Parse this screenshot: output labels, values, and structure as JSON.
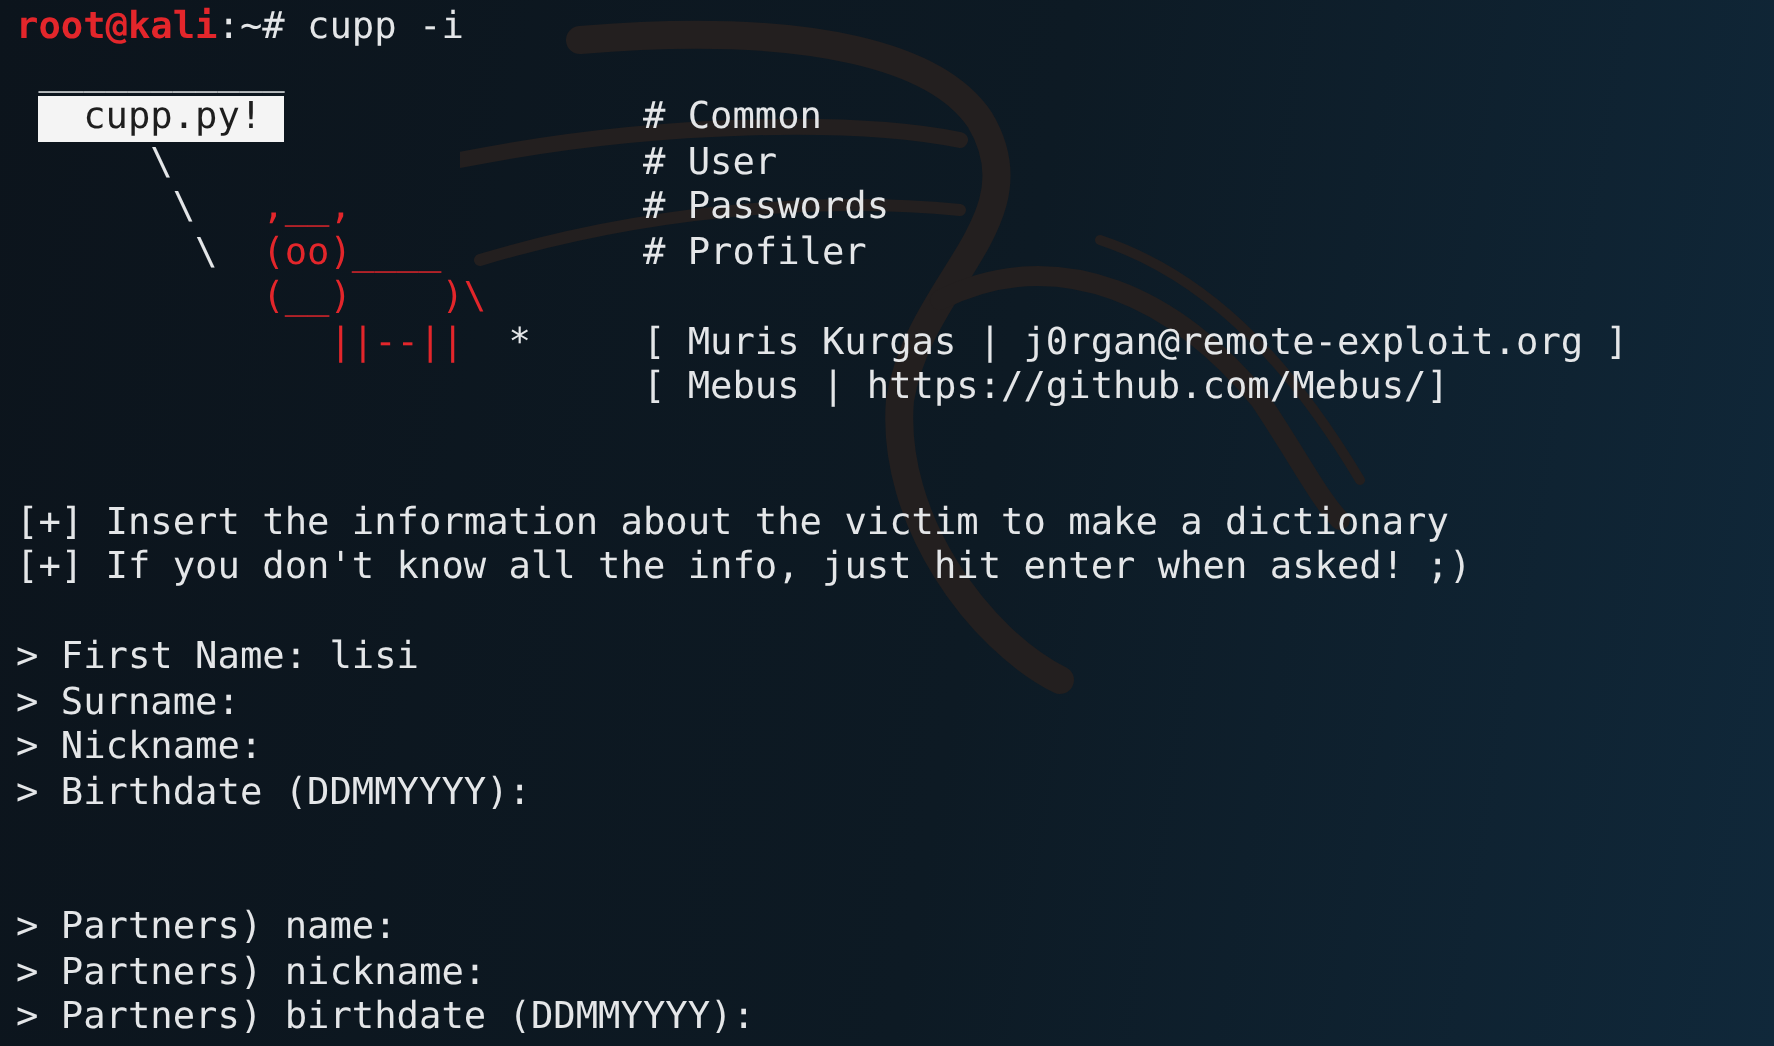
{
  "prompt": {
    "user_host": "root@kali",
    "command": ":~# cupp -i"
  },
  "banner_rows": [
    {
      "art": [
        {
          "text": " ___________",
          "kind": "line"
        }
      ]
    },
    {
      "art": [
        {
          "text": "  cupp.py! ",
          "kind": "banner"
        }
      ],
      "info": "# Common"
    },
    {
      "art": [
        {
          "text": "      \\",
          "kind": "line"
        }
      ],
      "info": "# User"
    },
    {
      "art": [
        {
          "text": "       \\",
          "kind": "line"
        },
        {
          "text": "   ,__,",
          "kind": "cow"
        }
      ],
      "info": "# Passwords"
    },
    {
      "art": [
        {
          "text": "        \\",
          "kind": "line"
        },
        {
          "text": "  (oo)____",
          "kind": "cow"
        }
      ],
      "info": "# Profiler"
    },
    {
      "art": [
        {
          "text": "           (__)    )\\",
          "kind": "cow"
        }
      ]
    },
    {
      "art": [
        {
          "text": "              ||--||",
          "kind": "cow"
        },
        {
          "text": "  *",
          "kind": "line"
        }
      ],
      "info": "[ Muris Kurgas | j0rgan@remote-exploit.org ]"
    },
    {
      "art": [],
      "info": "[ Mebus | https://github.com/Mebus/]"
    }
  ],
  "lines": [
    {
      "kind": "blank"
    },
    {
      "kind": "blank"
    },
    {
      "kind": "message",
      "text": "[+] Insert the information about the victim to make a dictionary"
    },
    {
      "kind": "message",
      "text": "[+] If you don't know all the info, just hit enter when asked! ;)"
    },
    {
      "kind": "blank"
    },
    {
      "kind": "input",
      "label": "> First Name:",
      "value": "lisi"
    },
    {
      "kind": "input",
      "label": "> Surname:"
    },
    {
      "kind": "input",
      "label": "> Nickname:"
    },
    {
      "kind": "input",
      "label": "> Birthdate (DDMMYYYY):"
    },
    {
      "kind": "blank"
    },
    {
      "kind": "blank"
    },
    {
      "kind": "input",
      "label": "> Partners) name:"
    },
    {
      "kind": "input",
      "label": "> Partners) nickname:"
    },
    {
      "kind": "input",
      "label": "> Partners) birthdate (DDMMYYYY):"
    }
  ]
}
